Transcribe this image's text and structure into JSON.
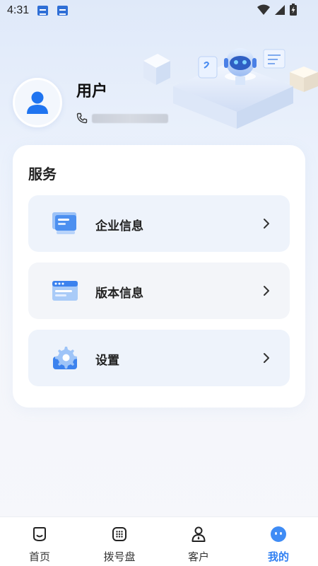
{
  "status_bar": {
    "time": "4:31",
    "icons": [
      "notification-icon",
      "notification-icon",
      "wifi-icon",
      "signal-icon",
      "battery-charging-icon"
    ]
  },
  "profile": {
    "username": "用户",
    "phone_icon": "phone-icon",
    "phone_masked": true
  },
  "services": {
    "title": "服务",
    "items": [
      {
        "label": "企业信息",
        "icon": "company-info-icon"
      },
      {
        "label": "版本信息",
        "icon": "version-info-icon"
      },
      {
        "label": "设置",
        "icon": "settings-gear-icon"
      }
    ]
  },
  "tabbar": {
    "tabs": [
      {
        "label": "首页",
        "icon": "home-icon",
        "active": false
      },
      {
        "label": "拨号盘",
        "icon": "dialpad-icon",
        "active": false
      },
      {
        "label": "客户",
        "icon": "customer-icon",
        "active": false
      },
      {
        "label": "我的",
        "icon": "profile-face-icon",
        "active": true
      }
    ]
  },
  "colors": {
    "accent": "#2f7ff2",
    "card_bg": "#ffffff",
    "item_bg": "#eef3fb",
    "page_bg_top": "#dfe9f9"
  }
}
